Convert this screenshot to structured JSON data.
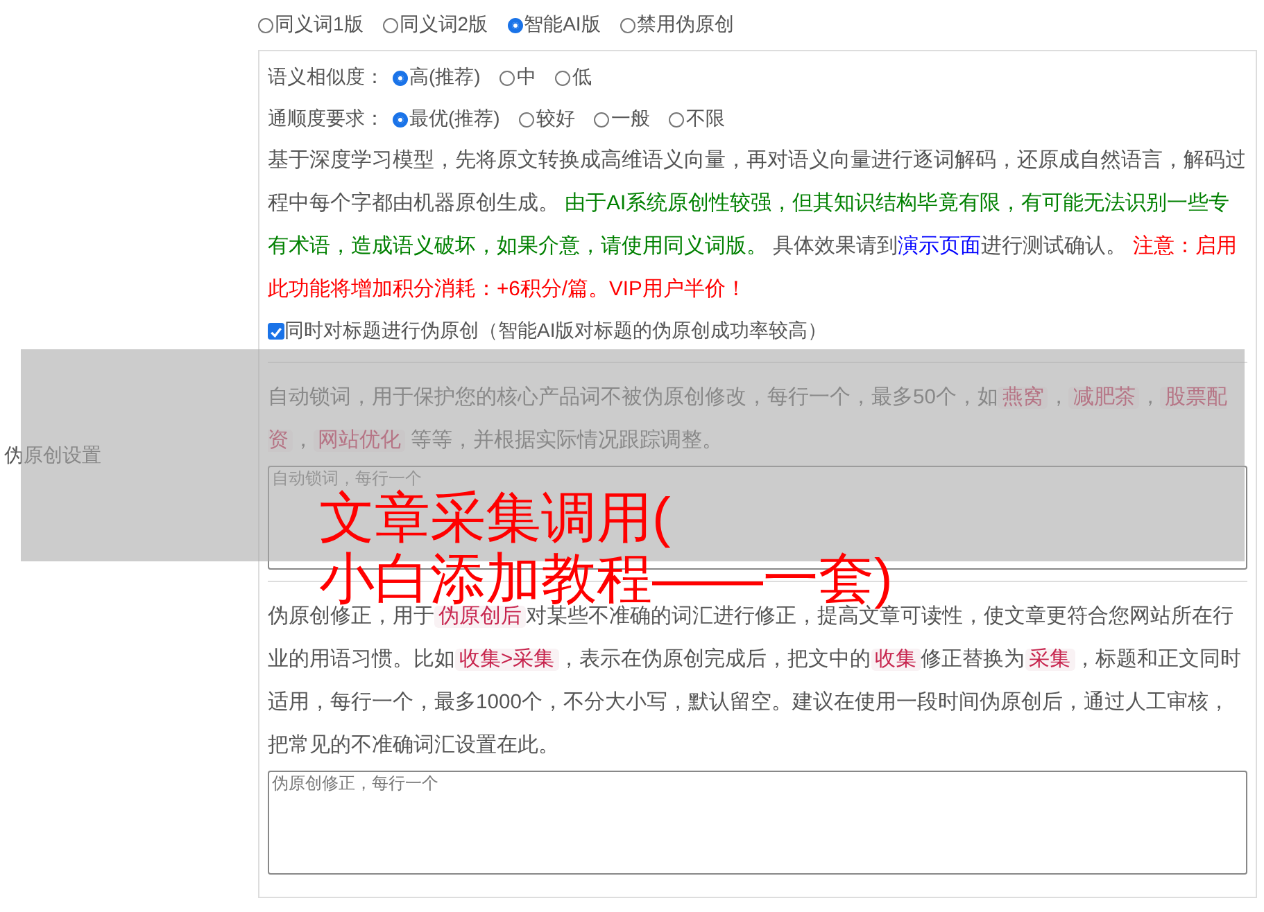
{
  "side_label": "伪原创设置",
  "modes": [
    {
      "label": "同义词1版",
      "selected": false
    },
    {
      "label": "同义词2版",
      "selected": false
    },
    {
      "label": "智能AI版",
      "selected": true
    },
    {
      "label": "禁用伪原创",
      "selected": false
    }
  ],
  "similarity": {
    "label": "语义相似度：",
    "options": [
      {
        "label": "高(推荐)",
        "selected": true
      },
      {
        "label": "中",
        "selected": false
      },
      {
        "label": "低",
        "selected": false
      }
    ]
  },
  "fluency": {
    "label": "通顺度要求：",
    "options": [
      {
        "label": "最优(推荐)",
        "selected": true
      },
      {
        "label": "较好",
        "selected": false
      },
      {
        "label": "一般",
        "selected": false
      },
      {
        "label": "不限",
        "selected": false
      }
    ]
  },
  "ai_description": [
    {
      "kind": "text",
      "text": "基于深度学习模型，先将原文转换成高维语义向量，再对语义向量进行逐词解码，还原成自然语言，解码过程中每个字都由机器原创生成。 "
    },
    {
      "kind": "green",
      "text": "由于AI系统原创性较强，但其知识结构毕竟有限，有可能无法识别一些专有术语，造成语义破坏，如果介意，请使用同义词版。"
    },
    {
      "kind": "text",
      "text": " 具体效果请到"
    },
    {
      "kind": "link",
      "text": "演示页面"
    },
    {
      "kind": "text",
      "text": "进行测试确认。 "
    },
    {
      "kind": "red",
      "text": "注意：启用此功能将增加积分消耗：+6积分/篇。VIP用户半价！"
    }
  ],
  "title_option": {
    "label": "同时对标题进行伪原创（智能AI版对标题的伪原创成功率较高）",
    "checked": true
  },
  "lock_words": {
    "description": [
      {
        "kind": "text",
        "text": "自动锁词，用于保护您的核心产品词不被伪原创修改，每行一个，最多50个，如"
      },
      {
        "kind": "code",
        "text": "燕窝"
      },
      {
        "kind": "text",
        "text": "，"
      },
      {
        "kind": "code",
        "text": "减肥茶"
      },
      {
        "kind": "text",
        "text": "，"
      },
      {
        "kind": "code",
        "text": "股票配资"
      },
      {
        "kind": "text",
        "text": "，"
      },
      {
        "kind": "code",
        "text": "网站优化"
      },
      {
        "kind": "text",
        "text": " 等等，并根据实际情况跟踪调整。"
      }
    ],
    "placeholder": "自动锁词，每行一个"
  },
  "corrections": {
    "description": [
      {
        "kind": "text",
        "text": "伪原创修正，用于"
      },
      {
        "kind": "code",
        "text": "伪原创后"
      },
      {
        "kind": "text",
        "text": "对某些不准确的词汇进行修正，提高文章可读性，使文章更符合您网站所在行业的用语习惯。比如"
      },
      {
        "kind": "code",
        "text": "收集>采集"
      },
      {
        "kind": "text",
        "text": "，表示在伪原创完成后，把文中的"
      },
      {
        "kind": "code",
        "text": "收集"
      },
      {
        "kind": "text",
        "text": "修正替换为"
      },
      {
        "kind": "code",
        "text": "采集"
      },
      {
        "kind": "text",
        "text": "，标题和正文同时适用，每行一个，最多1000个，不分大小写，默认留空。建议在使用一段时间伪原创后，通过人工审核，把常见的不准确词汇设置在此。"
      }
    ],
    "placeholder": "伪原创修正，每行一个"
  },
  "overlay": {
    "title_lines": [
      "文章采集调用(",
      "小白添加教程——一套)"
    ]
  }
}
